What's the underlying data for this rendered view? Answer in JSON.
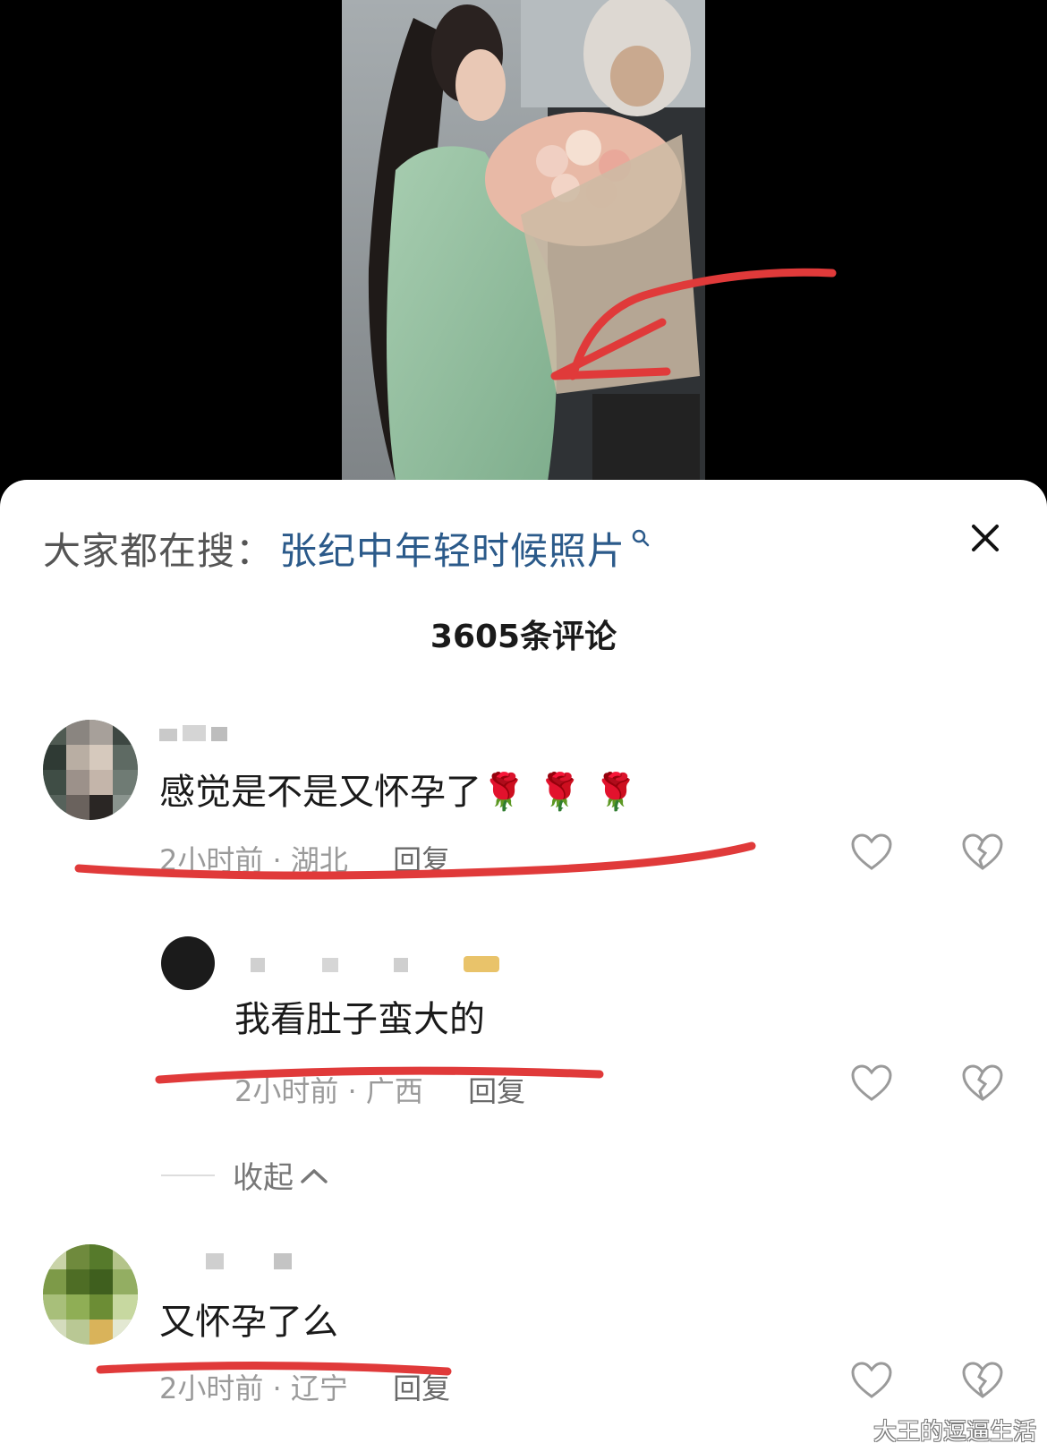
{
  "search": {
    "prefix": "大家都在搜：",
    "query": "张纪中年轻时候照片"
  },
  "comment_count": "3605条评论",
  "comments": [
    {
      "text": "感觉是不是又怀孕了🌹 🌹 🌹",
      "meta": "2小时前 · 湖北",
      "reply": "回复"
    },
    {
      "text": "我看肚子蛮大的",
      "meta": "2小时前 · 广西",
      "reply": "回复"
    },
    {
      "text": "又怀孕了么",
      "meta": "2小时前 · 辽宁",
      "reply": "回复"
    }
  ],
  "collapse_label": "收起",
  "watermark": "大王的逗逼生活",
  "colors": {
    "annotation_red": "#e03a3a",
    "search_link": "#2b5a8a"
  },
  "icons": [
    "search-icon",
    "close-icon",
    "heart-icon",
    "broken-heart-icon",
    "chevron-up-icon"
  ]
}
